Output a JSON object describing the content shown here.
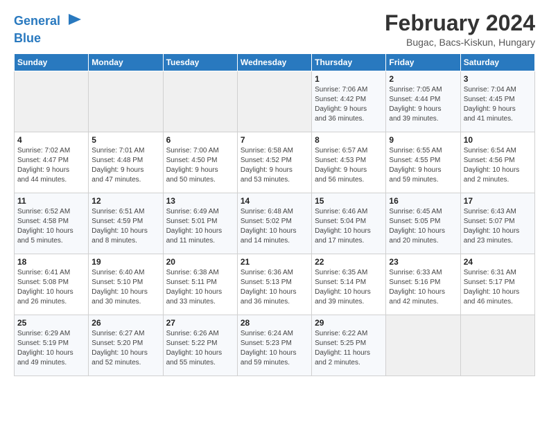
{
  "logo": {
    "line1": "General",
    "line2": "Blue"
  },
  "title": "February 2024",
  "location": "Bugac, Bacs-Kiskun, Hungary",
  "weekdays": [
    "Sunday",
    "Monday",
    "Tuesday",
    "Wednesday",
    "Thursday",
    "Friday",
    "Saturday"
  ],
  "weeks": [
    [
      {
        "day": "",
        "info": ""
      },
      {
        "day": "",
        "info": ""
      },
      {
        "day": "",
        "info": ""
      },
      {
        "day": "",
        "info": ""
      },
      {
        "day": "1",
        "info": "Sunrise: 7:06 AM\nSunset: 4:42 PM\nDaylight: 9 hours\nand 36 minutes."
      },
      {
        "day": "2",
        "info": "Sunrise: 7:05 AM\nSunset: 4:44 PM\nDaylight: 9 hours\nand 39 minutes."
      },
      {
        "day": "3",
        "info": "Sunrise: 7:04 AM\nSunset: 4:45 PM\nDaylight: 9 hours\nand 41 minutes."
      }
    ],
    [
      {
        "day": "4",
        "info": "Sunrise: 7:02 AM\nSunset: 4:47 PM\nDaylight: 9 hours\nand 44 minutes."
      },
      {
        "day": "5",
        "info": "Sunrise: 7:01 AM\nSunset: 4:48 PM\nDaylight: 9 hours\nand 47 minutes."
      },
      {
        "day": "6",
        "info": "Sunrise: 7:00 AM\nSunset: 4:50 PM\nDaylight: 9 hours\nand 50 minutes."
      },
      {
        "day": "7",
        "info": "Sunrise: 6:58 AM\nSunset: 4:52 PM\nDaylight: 9 hours\nand 53 minutes."
      },
      {
        "day": "8",
        "info": "Sunrise: 6:57 AM\nSunset: 4:53 PM\nDaylight: 9 hours\nand 56 minutes."
      },
      {
        "day": "9",
        "info": "Sunrise: 6:55 AM\nSunset: 4:55 PM\nDaylight: 9 hours\nand 59 minutes."
      },
      {
        "day": "10",
        "info": "Sunrise: 6:54 AM\nSunset: 4:56 PM\nDaylight: 10 hours\nand 2 minutes."
      }
    ],
    [
      {
        "day": "11",
        "info": "Sunrise: 6:52 AM\nSunset: 4:58 PM\nDaylight: 10 hours\nand 5 minutes."
      },
      {
        "day": "12",
        "info": "Sunrise: 6:51 AM\nSunset: 4:59 PM\nDaylight: 10 hours\nand 8 minutes."
      },
      {
        "day": "13",
        "info": "Sunrise: 6:49 AM\nSunset: 5:01 PM\nDaylight: 10 hours\nand 11 minutes."
      },
      {
        "day": "14",
        "info": "Sunrise: 6:48 AM\nSunset: 5:02 PM\nDaylight: 10 hours\nand 14 minutes."
      },
      {
        "day": "15",
        "info": "Sunrise: 6:46 AM\nSunset: 5:04 PM\nDaylight: 10 hours\nand 17 minutes."
      },
      {
        "day": "16",
        "info": "Sunrise: 6:45 AM\nSunset: 5:05 PM\nDaylight: 10 hours\nand 20 minutes."
      },
      {
        "day": "17",
        "info": "Sunrise: 6:43 AM\nSunset: 5:07 PM\nDaylight: 10 hours\nand 23 minutes."
      }
    ],
    [
      {
        "day": "18",
        "info": "Sunrise: 6:41 AM\nSunset: 5:08 PM\nDaylight: 10 hours\nand 26 minutes."
      },
      {
        "day": "19",
        "info": "Sunrise: 6:40 AM\nSunset: 5:10 PM\nDaylight: 10 hours\nand 30 minutes."
      },
      {
        "day": "20",
        "info": "Sunrise: 6:38 AM\nSunset: 5:11 PM\nDaylight: 10 hours\nand 33 minutes."
      },
      {
        "day": "21",
        "info": "Sunrise: 6:36 AM\nSunset: 5:13 PM\nDaylight: 10 hours\nand 36 minutes."
      },
      {
        "day": "22",
        "info": "Sunrise: 6:35 AM\nSunset: 5:14 PM\nDaylight: 10 hours\nand 39 minutes."
      },
      {
        "day": "23",
        "info": "Sunrise: 6:33 AM\nSunset: 5:16 PM\nDaylight: 10 hours\nand 42 minutes."
      },
      {
        "day": "24",
        "info": "Sunrise: 6:31 AM\nSunset: 5:17 PM\nDaylight: 10 hours\nand 46 minutes."
      }
    ],
    [
      {
        "day": "25",
        "info": "Sunrise: 6:29 AM\nSunset: 5:19 PM\nDaylight: 10 hours\nand 49 minutes."
      },
      {
        "day": "26",
        "info": "Sunrise: 6:27 AM\nSunset: 5:20 PM\nDaylight: 10 hours\nand 52 minutes."
      },
      {
        "day": "27",
        "info": "Sunrise: 6:26 AM\nSunset: 5:22 PM\nDaylight: 10 hours\nand 55 minutes."
      },
      {
        "day": "28",
        "info": "Sunrise: 6:24 AM\nSunset: 5:23 PM\nDaylight: 10 hours\nand 59 minutes."
      },
      {
        "day": "29",
        "info": "Sunrise: 6:22 AM\nSunset: 5:25 PM\nDaylight: 11 hours\nand 2 minutes."
      },
      {
        "day": "",
        "info": ""
      },
      {
        "day": "",
        "info": ""
      }
    ]
  ]
}
